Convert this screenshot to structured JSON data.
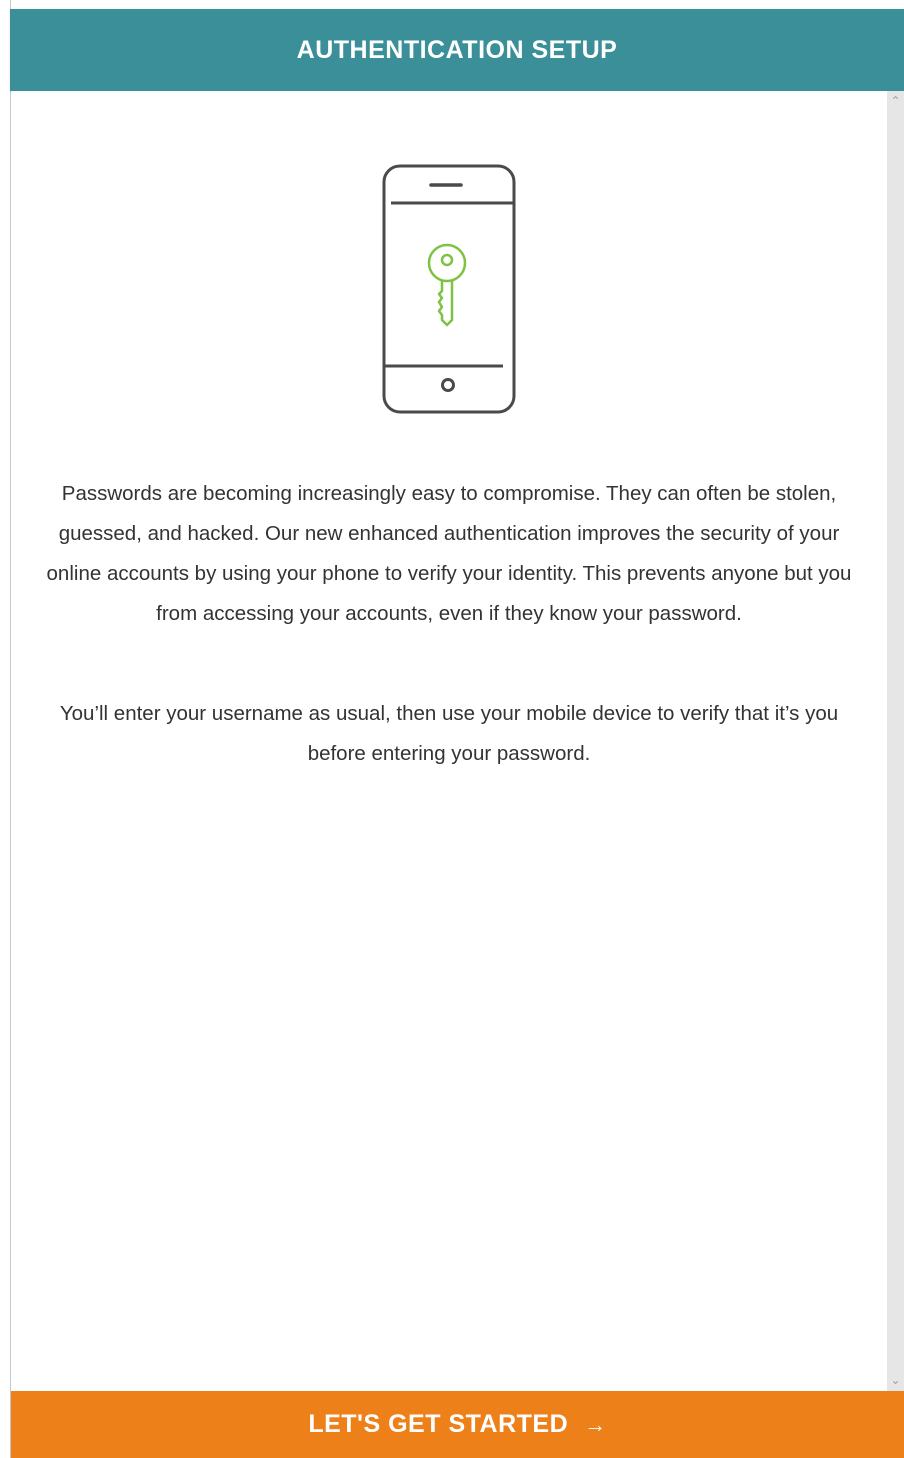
{
  "header": {
    "title": "AUTHENTICATION SETUP"
  },
  "illustration": {
    "icon": "phone-with-key-icon",
    "phone_color": "#4a4a4a",
    "key_color": "#7dc242"
  },
  "body": {
    "paragraph_1": "Passwords are becoming increasingly easy to compromise. They can often be stolen, guessed, and hacked. Our new enhanced authentication improves the security of your online accounts by using your phone to verify your identity. This prevents anyone but you from accessing your accounts, even if they know your password.",
    "paragraph_2": "You’ll enter your username as usual, then use your mobile device to verify that it’s you before entering your password."
  },
  "cta": {
    "label": "LET'S GET STARTED",
    "arrow": "→"
  },
  "colors": {
    "header_bg": "#3a8f98",
    "cta_bg": "#ee8019",
    "text": "#333333"
  }
}
